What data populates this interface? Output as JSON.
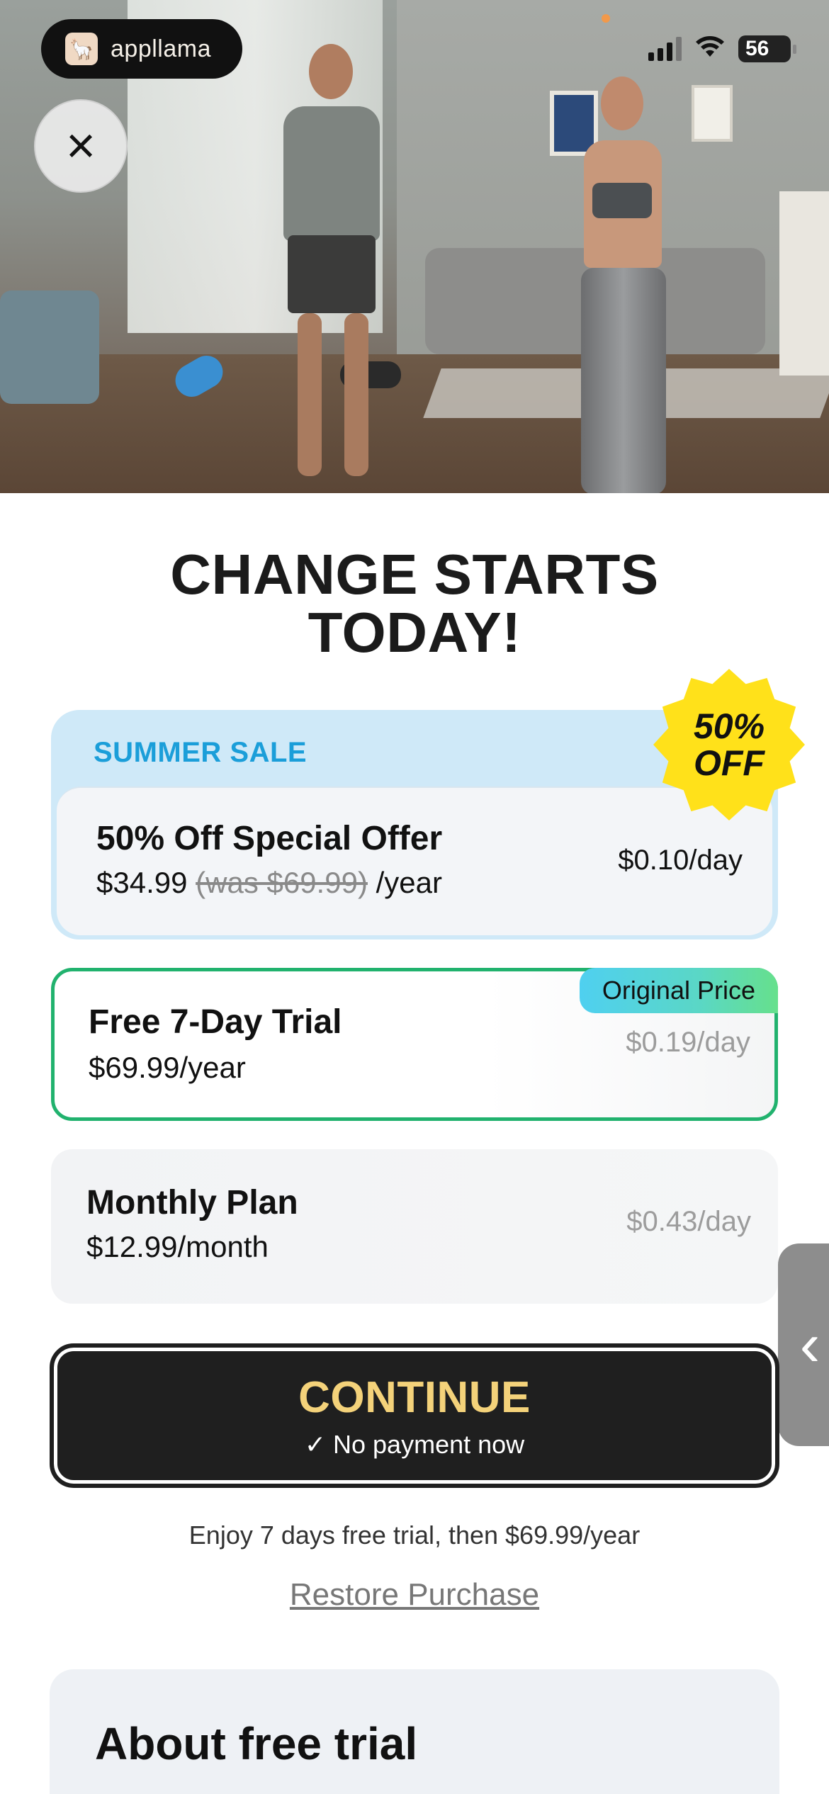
{
  "brand": {
    "name": "appllama",
    "logo_icon": "llama-logo-icon"
  },
  "status_bar": {
    "battery": "56",
    "signal_icon": "cellular-signal-icon",
    "wifi_icon": "wifi-icon"
  },
  "close_icon": "×",
  "headline": {
    "line1": "CHANGE STARTS",
    "line2": "TODAY!"
  },
  "sale_card": {
    "label": "SUMMER SALE",
    "badge_line1": "50%",
    "badge_line2": "OFF",
    "title": "50% Off Special Offer",
    "price": "$34.99",
    "was_price": "(was $69.99)",
    "period": "/year",
    "per_day": "$0.10/day"
  },
  "trial_card": {
    "badge": "Original Price",
    "title": "Free 7-Day Trial",
    "price": "$69.99/year",
    "per_day": "$0.19/day"
  },
  "monthly_card": {
    "title": "Monthly Plan",
    "price": "$12.99/month",
    "per_day": "$0.43/day"
  },
  "side_tab_icon": "‹",
  "continue_button": {
    "label": "CONTINUE",
    "sub": "✓ No payment now"
  },
  "trial_note": "Enjoy 7 days free trial, then $69.99/year",
  "restore_link": "Restore Purchase",
  "about": {
    "title": "About free trial"
  },
  "colors": {
    "accent_green": "#21b26e",
    "sale_blue": "#1b9ed9",
    "badge_yellow": "#ffe11a",
    "cta_gold": "#f4d27a"
  }
}
